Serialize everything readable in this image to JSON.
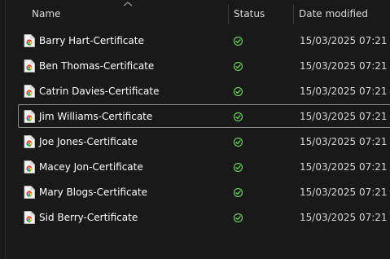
{
  "columns": {
    "name": "Name",
    "status": "Status",
    "date_modified": "Date modified"
  },
  "sort": {
    "column": "name",
    "direction": "ascending"
  },
  "colors": {
    "background": "#191919",
    "status_green": "#6ccb5f",
    "focus_border": "#8e8e8e"
  },
  "files": [
    {
      "name": "Barry Hart-Certificate",
      "icon": "chrome-html-file-icon",
      "status": "synced-check-icon",
      "date": "15/03/2025 07:21"
    },
    {
      "name": "Ben Thomas-Certificate",
      "icon": "chrome-html-file-icon",
      "status": "synced-check-icon",
      "date": "15/03/2025 07:21"
    },
    {
      "name": "Catrin Davies-Certificate",
      "icon": "chrome-html-file-icon",
      "status": "synced-check-icon",
      "date": "15/03/2025 07:21"
    },
    {
      "name": "Jim Williams-Certificate",
      "icon": "chrome-html-file-icon",
      "status": "synced-check-icon",
      "date": "15/03/2025 07:21",
      "focused": true
    },
    {
      "name": "Joe Jones-Certificate",
      "icon": "chrome-html-file-icon",
      "status": "synced-check-icon",
      "date": "15/03/2025 07:21"
    },
    {
      "name": "Macey Jon-Certificate",
      "icon": "chrome-html-file-icon",
      "status": "synced-check-icon",
      "date": "15/03/2025 07:21"
    },
    {
      "name": "Mary Blogs-Certificate",
      "icon": "chrome-html-file-icon",
      "status": "synced-check-icon",
      "date": "15/03/2025 07:21"
    },
    {
      "name": "Sid Berry-Certificate",
      "icon": "chrome-html-file-icon",
      "status": "synced-check-icon",
      "date": "15/03/2025 07:21"
    }
  ]
}
